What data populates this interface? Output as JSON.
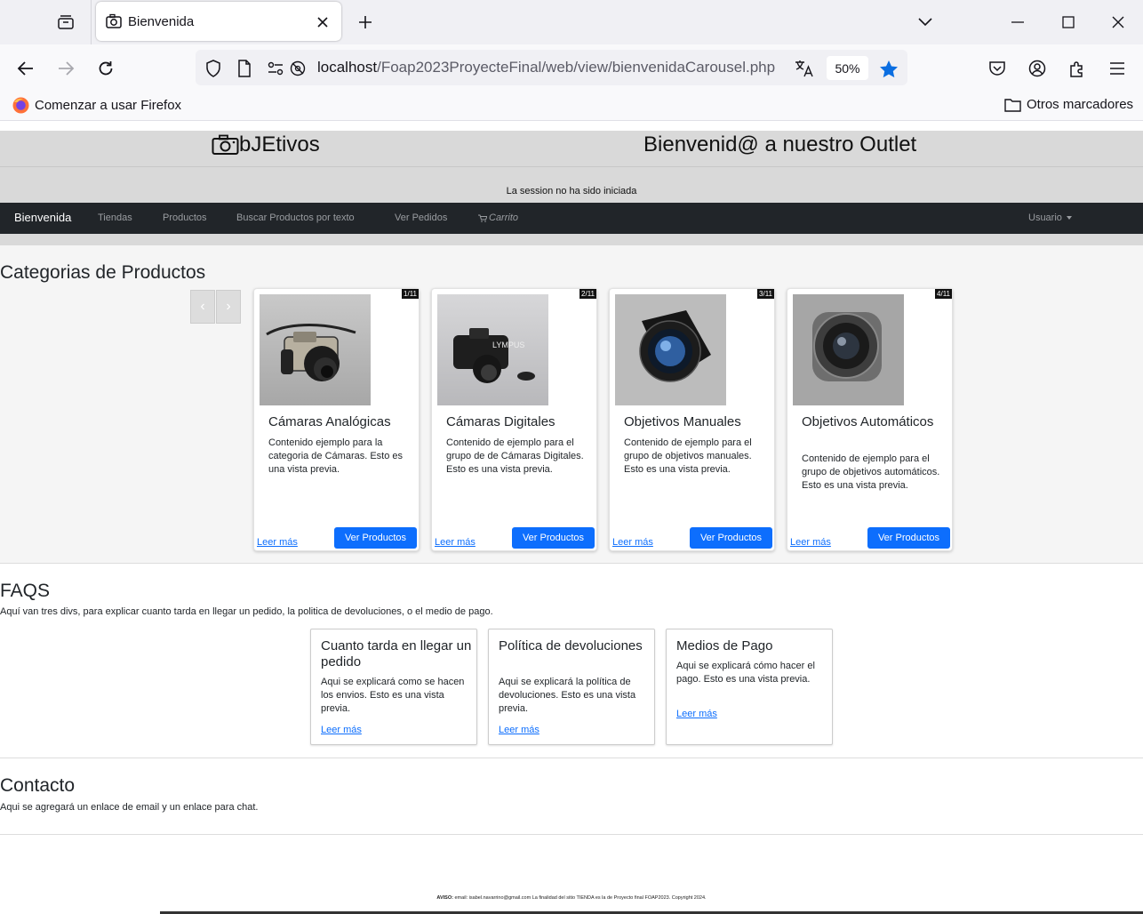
{
  "browser": {
    "tab": {
      "title": "Bienvenida"
    },
    "url": {
      "host": "localhost",
      "path": "/Foap2023ProyecteFinal/web/view/bienvenidaCarousel.php"
    },
    "zoom": "50%",
    "bookmarks": {
      "left": "Comenzar a usar Firefox",
      "right": "Otros marcadores"
    }
  },
  "header": {
    "logo_text": "bJEtivos",
    "welcome": "Bienvenid@ a nuestro Outlet",
    "session": "La session no ha sido iniciada"
  },
  "nav": {
    "brand": "Bienvenida",
    "items": [
      "Tiendas",
      "Productos",
      "Buscar Productos por texto",
      "Ver Pedidos"
    ],
    "cart": "Carrito",
    "user": "Usuario"
  },
  "categories": {
    "heading": "Categorias de Productos",
    "prev_arrow": "‹",
    "next_arrow": "›",
    "cards": [
      {
        "badge": "1/11",
        "title": "Cámaras Analógicas",
        "text": "Contenido ejemplo para la categoria de Cámaras. Esto es una vista previa.",
        "link": "Leer más",
        "button": "Ver Productos"
      },
      {
        "badge": "2/11",
        "title": "Cámaras Digitales",
        "text": "Contenido de ejemplo para el grupo de de Cámaras Digitales. Esto es una vista previa.",
        "link": "Leer más",
        "button": "Ver Productos"
      },
      {
        "badge": "3/11",
        "title": "Objetivos Manuales",
        "text": "Contenido de ejemplo para el grupo de objetivos manuales. Esto es una vista previa.",
        "link": "Leer más",
        "button": "Ver Productos"
      },
      {
        "badge": "4/11",
        "title": "Objetivos Automáticos",
        "text": "Contenido de ejemplo para el grupo de objetivos automáticos. Esto es una vista previa.",
        "link": "Leer más",
        "button": "Ver Productos"
      }
    ]
  },
  "faqs": {
    "heading": "FAQS",
    "description": "Aquí van tres divs, para explicar cuanto tarda en llegar un pedido, la politica de devoluciones, o el medio de pago.",
    "cards": [
      {
        "title": "Cuanto tarda en llegar un pedido",
        "text": "Aqui se explicará como se hacen los envios. Esto es una vista previa.",
        "link": "Leer más"
      },
      {
        "title": "Política de devoluciones",
        "text": "Aqui se explicará la política de devoluciones. Esto es una vista previa.",
        "link": "Leer más"
      },
      {
        "title": "Medios de Pago",
        "text": "Aqui se explicará cómo hacer el pago. Esto es una vista previa.",
        "link": "Leer más"
      }
    ]
  },
  "contact": {
    "heading": "Contacto",
    "description": "Aqui se agregará un enlace de email y un enlace para chat."
  },
  "footer": {
    "label": "AVISO:",
    "text": "email: isabel.navarrino@gmail.com La finalidad del sitio TIENDA es la de Proyecto final FOAP2023. Copyright 2024."
  }
}
